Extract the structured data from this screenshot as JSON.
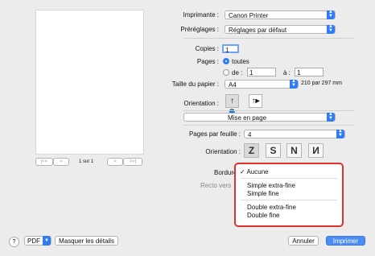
{
  "preview": {
    "page_indicator": "1 sur 1",
    "first": "|<<",
    "prev": "<",
    "next": ">",
    "last": ">>|"
  },
  "printer": {
    "label": "Imprimante :",
    "value": "Canon Printer"
  },
  "presets": {
    "label": "Préréglages :",
    "value": "Réglages par défaut"
  },
  "copies": {
    "label": "Copies :",
    "value": "1"
  },
  "pages": {
    "label": "Pages :",
    "all": "toutes",
    "from_label": "de :",
    "from": "1",
    "to_label": "à :",
    "to": "1"
  },
  "paper": {
    "label": "Taille du papier :",
    "value": "A4",
    "dimensions": "210 par 297 mm"
  },
  "orientation": {
    "label": "Orientation :"
  },
  "section": {
    "value": "Mise en page"
  },
  "pages_per_sheet": {
    "label": "Pages par feuille :",
    "value": "4"
  },
  "layout_direction": {
    "label": "Orientation :",
    "options": [
      "Z",
      "S",
      "N",
      "N"
    ]
  },
  "border": {
    "label": "Bordure"
  },
  "two_sided": {
    "label": "Recto vers"
  },
  "border_menu": {
    "selected": "✓ Aucune",
    "items": [
      "Simple extra-fine",
      "Simple fine",
      "Double extra-fine",
      "Double fine"
    ]
  },
  "footer": {
    "help": "?",
    "pdf": "PDF",
    "hide_details": "Masquer les détails",
    "cancel": "Annuler",
    "print": "Imprimer"
  },
  "colors": {
    "accent": "#2f7cf6",
    "highlight": "#e0302a"
  }
}
